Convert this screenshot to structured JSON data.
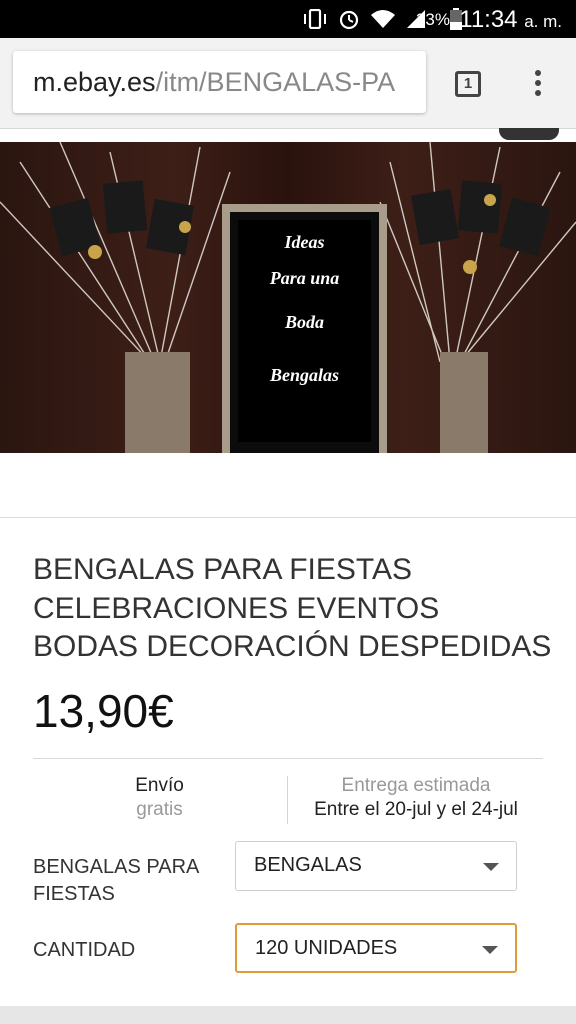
{
  "status_bar": {
    "battery": "33%",
    "time": "11:34",
    "ampm": "a. m.",
    "icons": [
      "vibrate-icon",
      "alarm-icon",
      "wifi-icon",
      "signal-icon",
      "battery-icon"
    ]
  },
  "browser": {
    "url_host": "m.ebay.es",
    "url_path": "/itm/BENGALAS-PA",
    "tab_count": "1"
  },
  "hero": {
    "lines": [
      "Ideas",
      "Para una",
      "Boda",
      "Bengalas"
    ]
  },
  "product": {
    "title_lines": [
      "BENGALAS PARA FIESTAS",
      "CELEBRACIONES EVENTOS",
      "BODAS DECORACIÓN DESPEDIDAS"
    ],
    "price": "13,90€"
  },
  "shipping": {
    "label": "Envío",
    "value": "gratis"
  },
  "delivery": {
    "label": "Entrega estimada",
    "value": "Entre el 20-jul y el 24-jul"
  },
  "options": [
    {
      "label_lines": [
        "BENGALAS PARA",
        "FIESTAS"
      ],
      "selected": "BENGALAS"
    },
    {
      "label_lines": [
        "CANTIDAD"
      ],
      "selected": "120 UNIDADES"
    }
  ],
  "colors": {
    "accent_border": "#e09a3a",
    "status_bar": "#000000"
  }
}
